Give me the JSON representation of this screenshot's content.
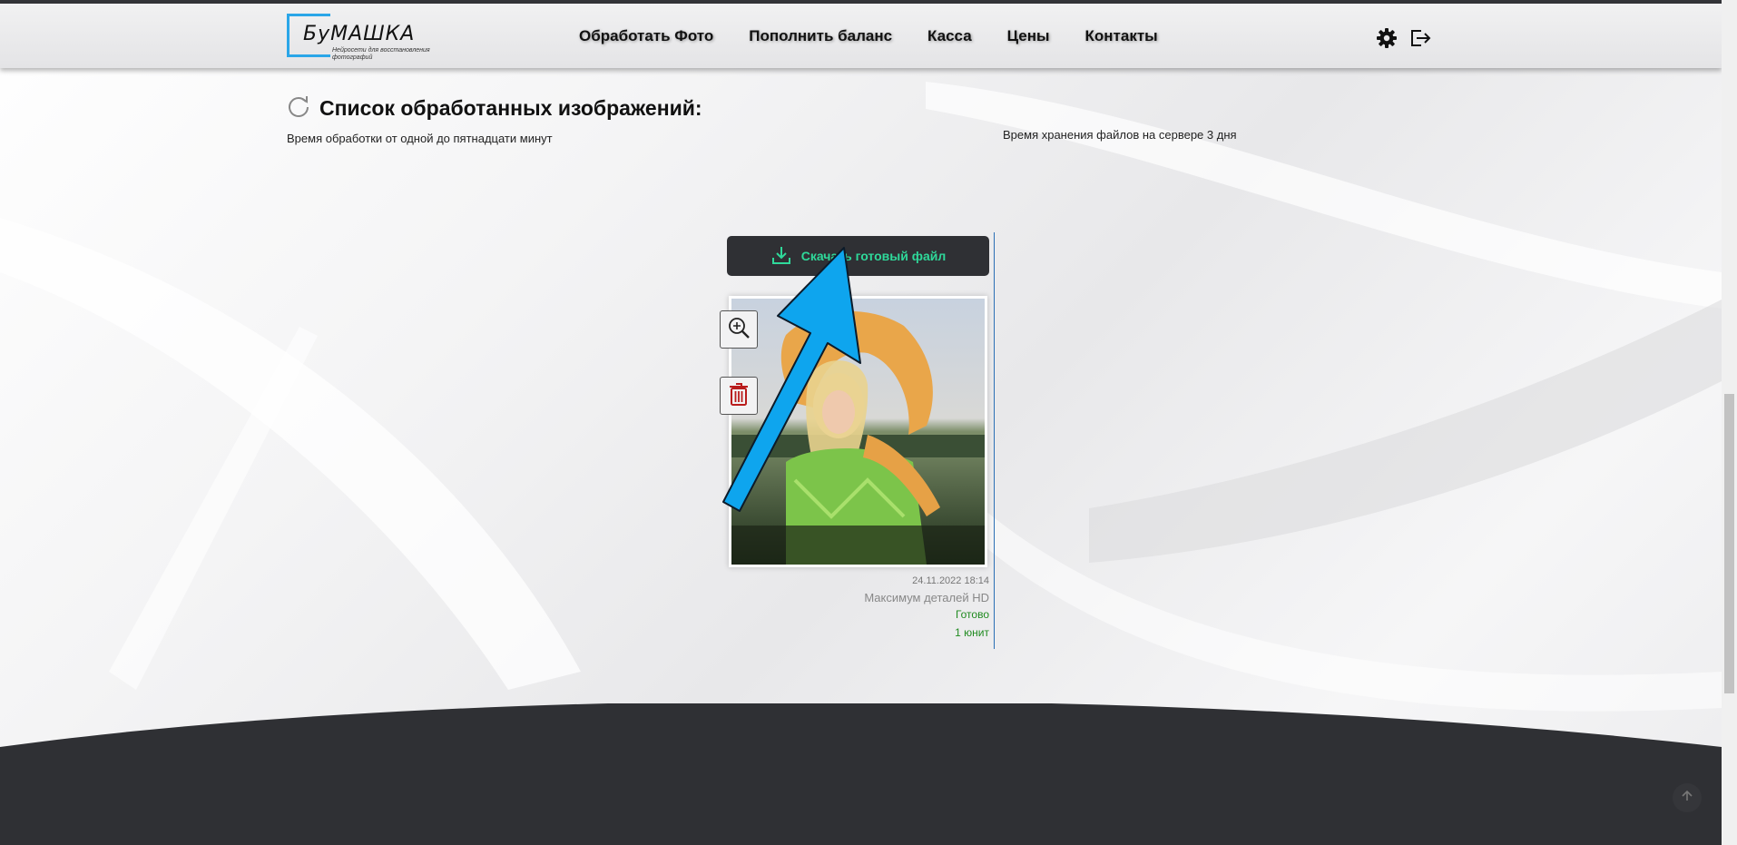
{
  "header": {
    "logo_text": "БуМАШКА",
    "logo_subtitle": "Нейросети для восстановления фотографий",
    "nav": [
      {
        "label": "Обработать Фото"
      },
      {
        "label": "Пополнить баланс"
      },
      {
        "label": "Касса"
      },
      {
        "label": "Цены"
      },
      {
        "label": "Контакты"
      }
    ],
    "icons": [
      "gear-icon",
      "logout-icon"
    ]
  },
  "main": {
    "title": "Список обработанных изображений:",
    "processing_note": "Время обработки от одной до пятнадцати минут",
    "storage_note": "Время хранения файлов на сервере 3 дня"
  },
  "card": {
    "download_label": "Скачать готовый файл",
    "date": "24.11.2022 18:14",
    "mode": "Максимум деталей HD",
    "status": "Готово",
    "cost": "1 юнит"
  },
  "colors": {
    "accent_green": "#2fd99a",
    "status_green": "#1f8a1f",
    "logo_blue": "#2aa6e8",
    "annotation_arrow": "#0ea5ee",
    "dark": "#2f3034"
  }
}
